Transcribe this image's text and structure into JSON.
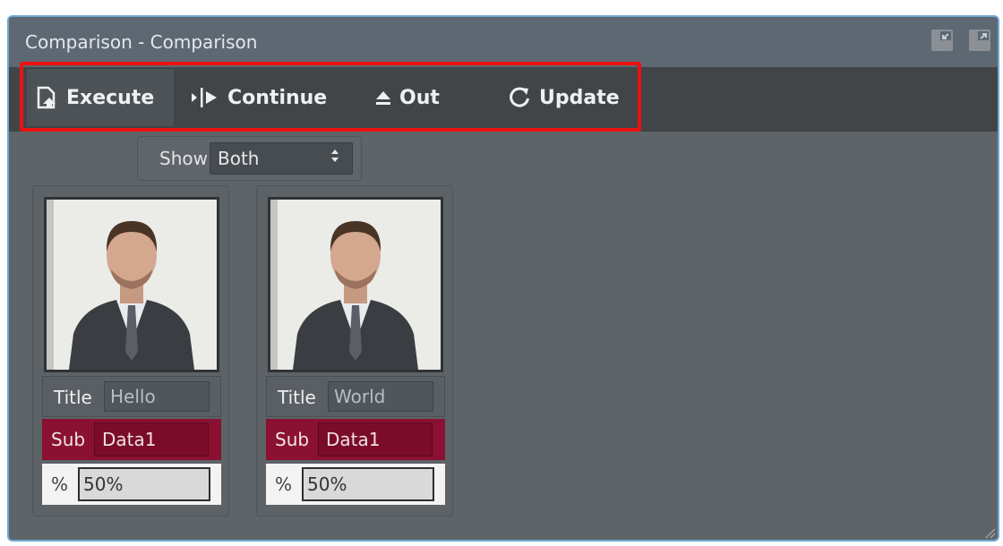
{
  "window": {
    "title": "Comparison - Comparison",
    "icons": [
      "restore-icon",
      "popout-icon"
    ]
  },
  "toolbar": {
    "execute_label": "Execute",
    "continue_label": "Continue",
    "out_label": "Out",
    "update_label": "Update",
    "highlight_color": "#ee1111"
  },
  "show": {
    "label": "Show",
    "value": "Both"
  },
  "cards": [
    {
      "title_label": "Title",
      "title_value": "Hello",
      "sub_label": "Sub",
      "sub_value": "Data1",
      "pct_label": "%",
      "pct_value": "50%"
    },
    {
      "title_label": "Title",
      "title_value": "World",
      "sub_label": "Sub",
      "sub_value": "Data1",
      "pct_label": "%",
      "pct_value": "50%"
    }
  ],
  "colors": {
    "window_bg": "#5f6468",
    "toolbar_bg": "#414548",
    "sub_row": "#8a1131",
    "accent_border": "#6fa7cf"
  }
}
